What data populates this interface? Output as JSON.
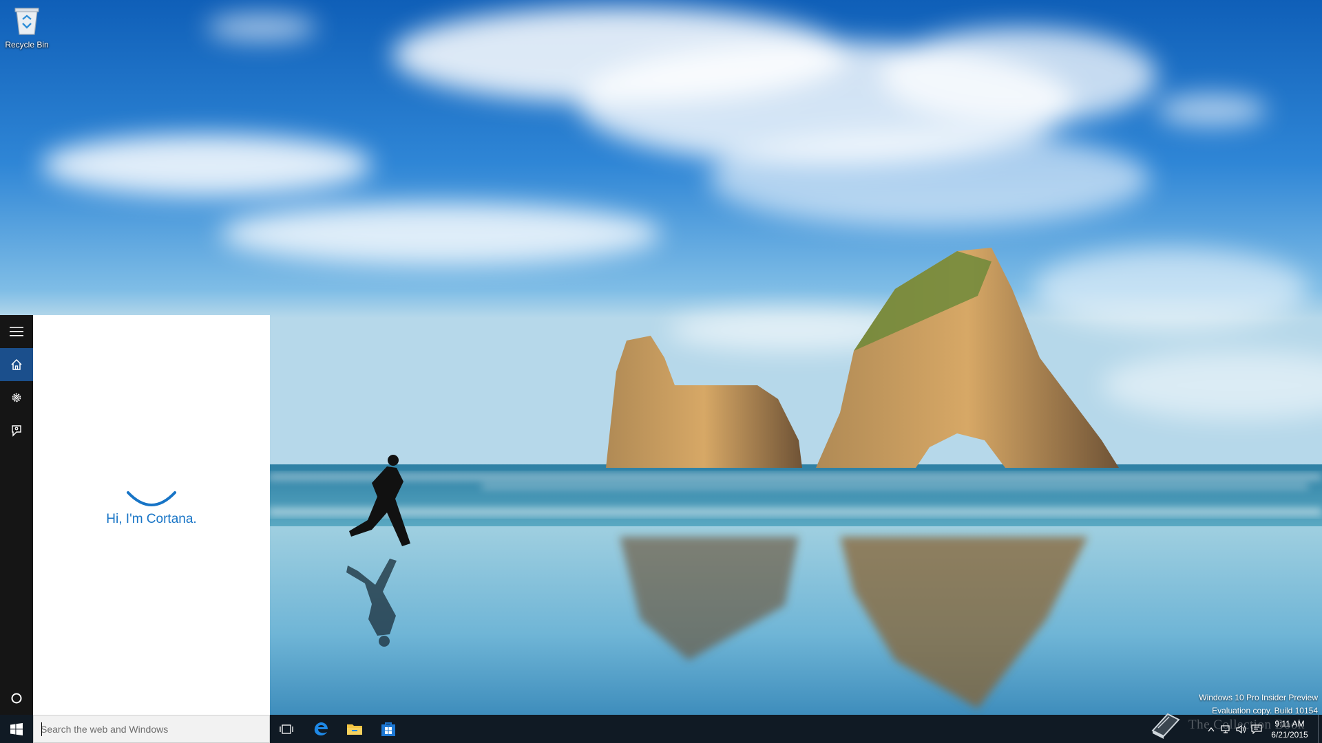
{
  "desktop": {
    "icons": [
      {
        "label": "Recycle Bin",
        "icon": "recycle-bin-icon"
      }
    ]
  },
  "cortana": {
    "greeting": "Hi, I'm Cortana.",
    "rail": [
      {
        "name": "menu",
        "icon": "hamburger-icon"
      },
      {
        "name": "home",
        "icon": "home-icon",
        "active": true
      },
      {
        "name": "settings",
        "icon": "gear-icon"
      },
      {
        "name": "feedback",
        "icon": "feedback-icon"
      }
    ],
    "accent": "#1774c6"
  },
  "taskbar": {
    "search_placeholder": "Search the web and Windows",
    "pinned": [
      {
        "name": "task-view",
        "icon": "task-view-icon"
      },
      {
        "name": "edge",
        "icon": "edge-icon"
      },
      {
        "name": "file-explorer",
        "icon": "folder-icon"
      },
      {
        "name": "store",
        "icon": "store-icon"
      }
    ],
    "clock": {
      "time": "9:11 AM",
      "date": "6/21/2015"
    },
    "brand_overlay": "The Collection Book"
  },
  "watermark": {
    "line1": "Windows 10 Pro Insider Preview",
    "line2": "Evaluation copy. Build 10154"
  }
}
